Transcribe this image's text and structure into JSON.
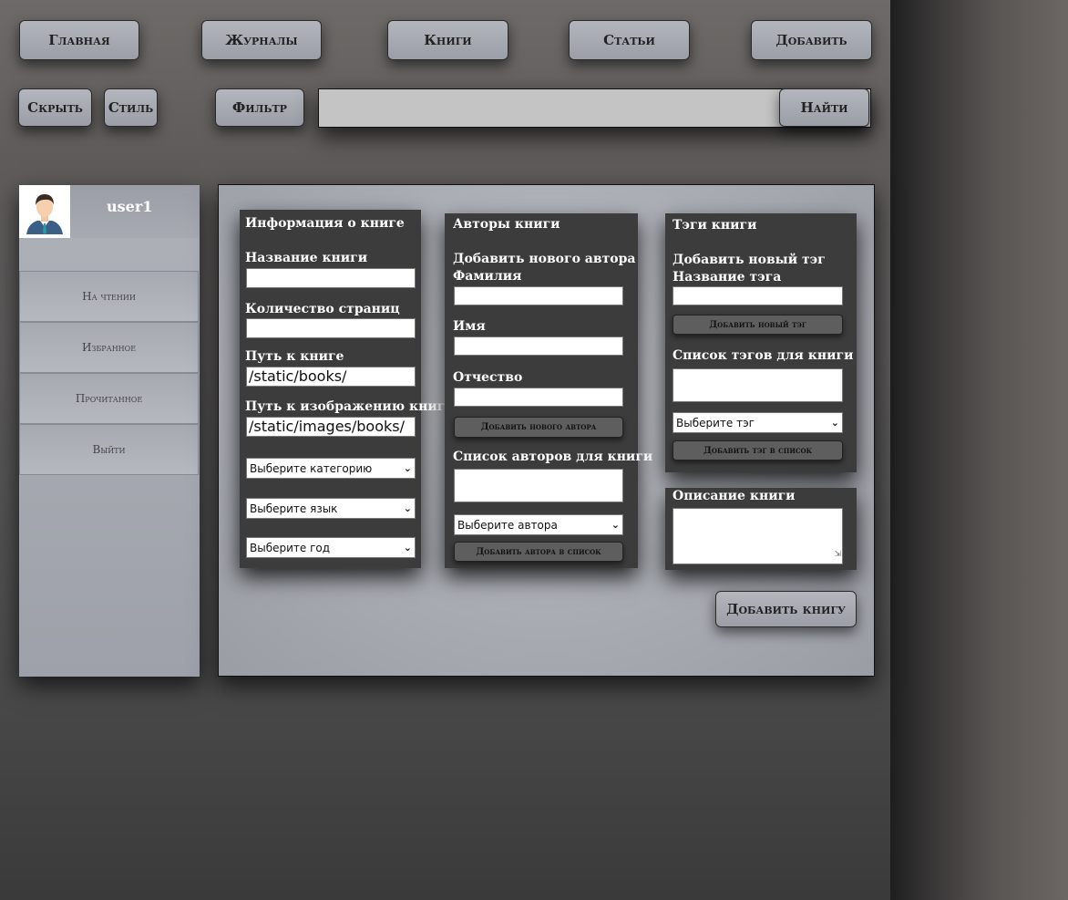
{
  "nav": {
    "home": "Главная",
    "journals": "Журналы",
    "books": "Книги",
    "articles": "Статьи",
    "add": "Добавить"
  },
  "toolbar": {
    "hide": "Скрыть",
    "style": "Стиль",
    "filter": "Фильтр",
    "search_value": "",
    "search_button": "Найти"
  },
  "sidebar": {
    "username": "user1",
    "items": [
      {
        "label": "На чтении"
      },
      {
        "label": "Избранное"
      },
      {
        "label": "Прочитанное"
      },
      {
        "label": "Выйти"
      }
    ]
  },
  "book_info": {
    "title": "Информация о книге",
    "name_label": "Название книги",
    "name_value": "",
    "pages_label": "Количество страниц",
    "pages_value": "",
    "path_label": "Путь к книге",
    "path_value": "/static/books/",
    "image_path_label": "Путь к изображению книги",
    "image_path_value": "/static/images/books/",
    "category_select": "Выберите категорию",
    "language_select": "Выберите язык",
    "year_select": "Выберите год"
  },
  "authors": {
    "title": "Авторы книги",
    "add_new_label": "Добавить нового автора",
    "surname_label": "Фамилия",
    "name_label": "Имя",
    "patronymic_label": "Отчество",
    "add_new_button": "Добавить нового автора",
    "list_label": "Список авторов для книги",
    "author_select": "Выберите автора",
    "add_to_list_button": "Добавить автора в список"
  },
  "tags": {
    "title": "Тэги книги",
    "add_new_label": "Добавить новый тэг",
    "tag_name_label": "Название тэга",
    "add_new_button": "Добавить новый тэг",
    "list_label": "Список тэгов для книги",
    "tag_select": "Выберите тэг",
    "add_to_list_button": "Добавить тэг в список"
  },
  "description": {
    "title": "Описание книги"
  },
  "submit": {
    "add_book": "Добавить книгу"
  }
}
